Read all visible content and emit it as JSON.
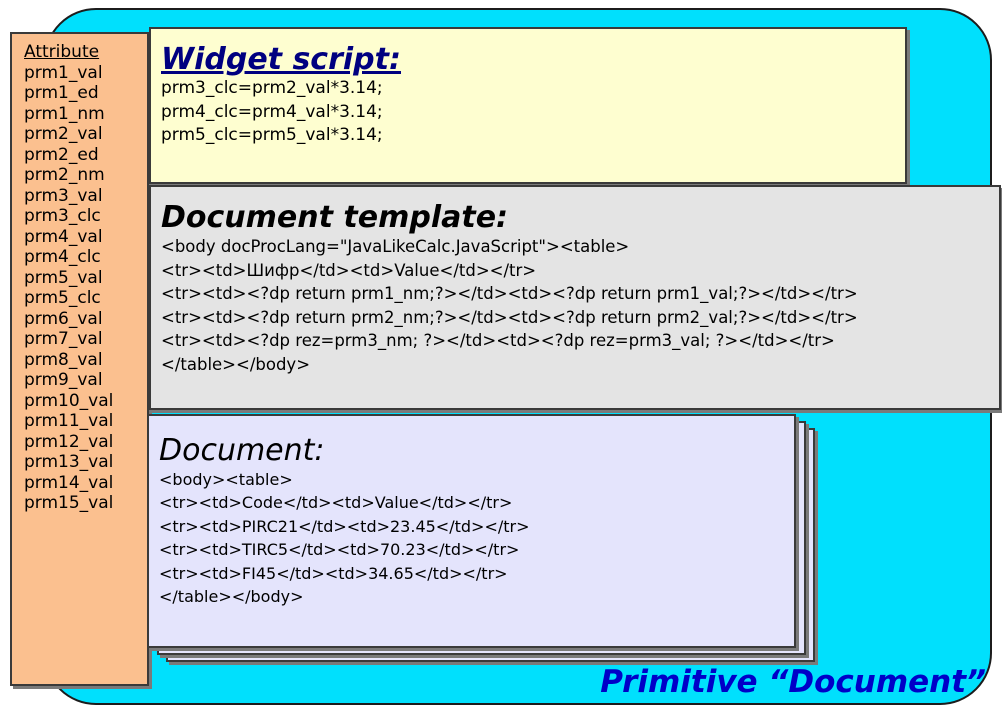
{
  "attributes": [
    "Attribute",
    "prm1_val",
    "prm1_ed",
    "prm1_nm",
    "prm2_val",
    "prm2_ed",
    "prm2_nm",
    "prm3_val",
    "prm3_clc",
    "prm4_val",
    "prm4_clc",
    "prm5_val",
    "prm5_clc",
    "prm6_val",
    "prm7_val",
    "prm8_val",
    "prm9_val",
    "prm10_val",
    "prm11_val",
    "prm12_val",
    "prm13_val",
    "prm14_val",
    "prm15_val"
  ],
  "widget_script": {
    "title": "Widget script:",
    "lines": [
      "prm3_clc=prm2_val*3.14;",
      "prm4_clc=prm4_val*3.14;",
      "prm5_clc=prm5_val*3.14;"
    ]
  },
  "document_template": {
    "title": "Document template:",
    "lines": [
      "<body docProcLang=\"JavaLikeCalc.JavaScript\"><table>",
      "<tr><td>Шифр</td><td>Value</td></tr>",
      "<tr><td><?dp return prm1_nm;?></td><td><?dp return prm1_val;?></td></tr>",
      "<tr><td><?dp return prm2_nm;?></td><td><?dp return prm2_val;?></td></tr>",
      "<tr><td><?dp rez=prm3_nm; ?></td><td><?dp rez=prm3_val; ?></td></tr>",
      "</table></body>"
    ]
  },
  "document": {
    "title": "Document:",
    "lines": [
      "<body><table>",
      "<tr><td>Code</td><td>Value</td></tr>",
      "<tr><td>PIRC21</td><td>23.45</td></tr>",
      "<tr><td>TIRC5</td><td>70.23</td></tr>",
      "<tr><td>FI45</td><td>34.65</td></tr>",
      "</table></body>"
    ]
  },
  "primitive_label": "Primitive “Document”",
  "colors": {
    "background_panel": "#00e0fd",
    "attribute_column": "#fbc08f",
    "widget_script_box": "#fefed0",
    "template_box": "#e4e4e4",
    "document_box": "#e4e4fc",
    "primitive_label": "#0000c8"
  }
}
